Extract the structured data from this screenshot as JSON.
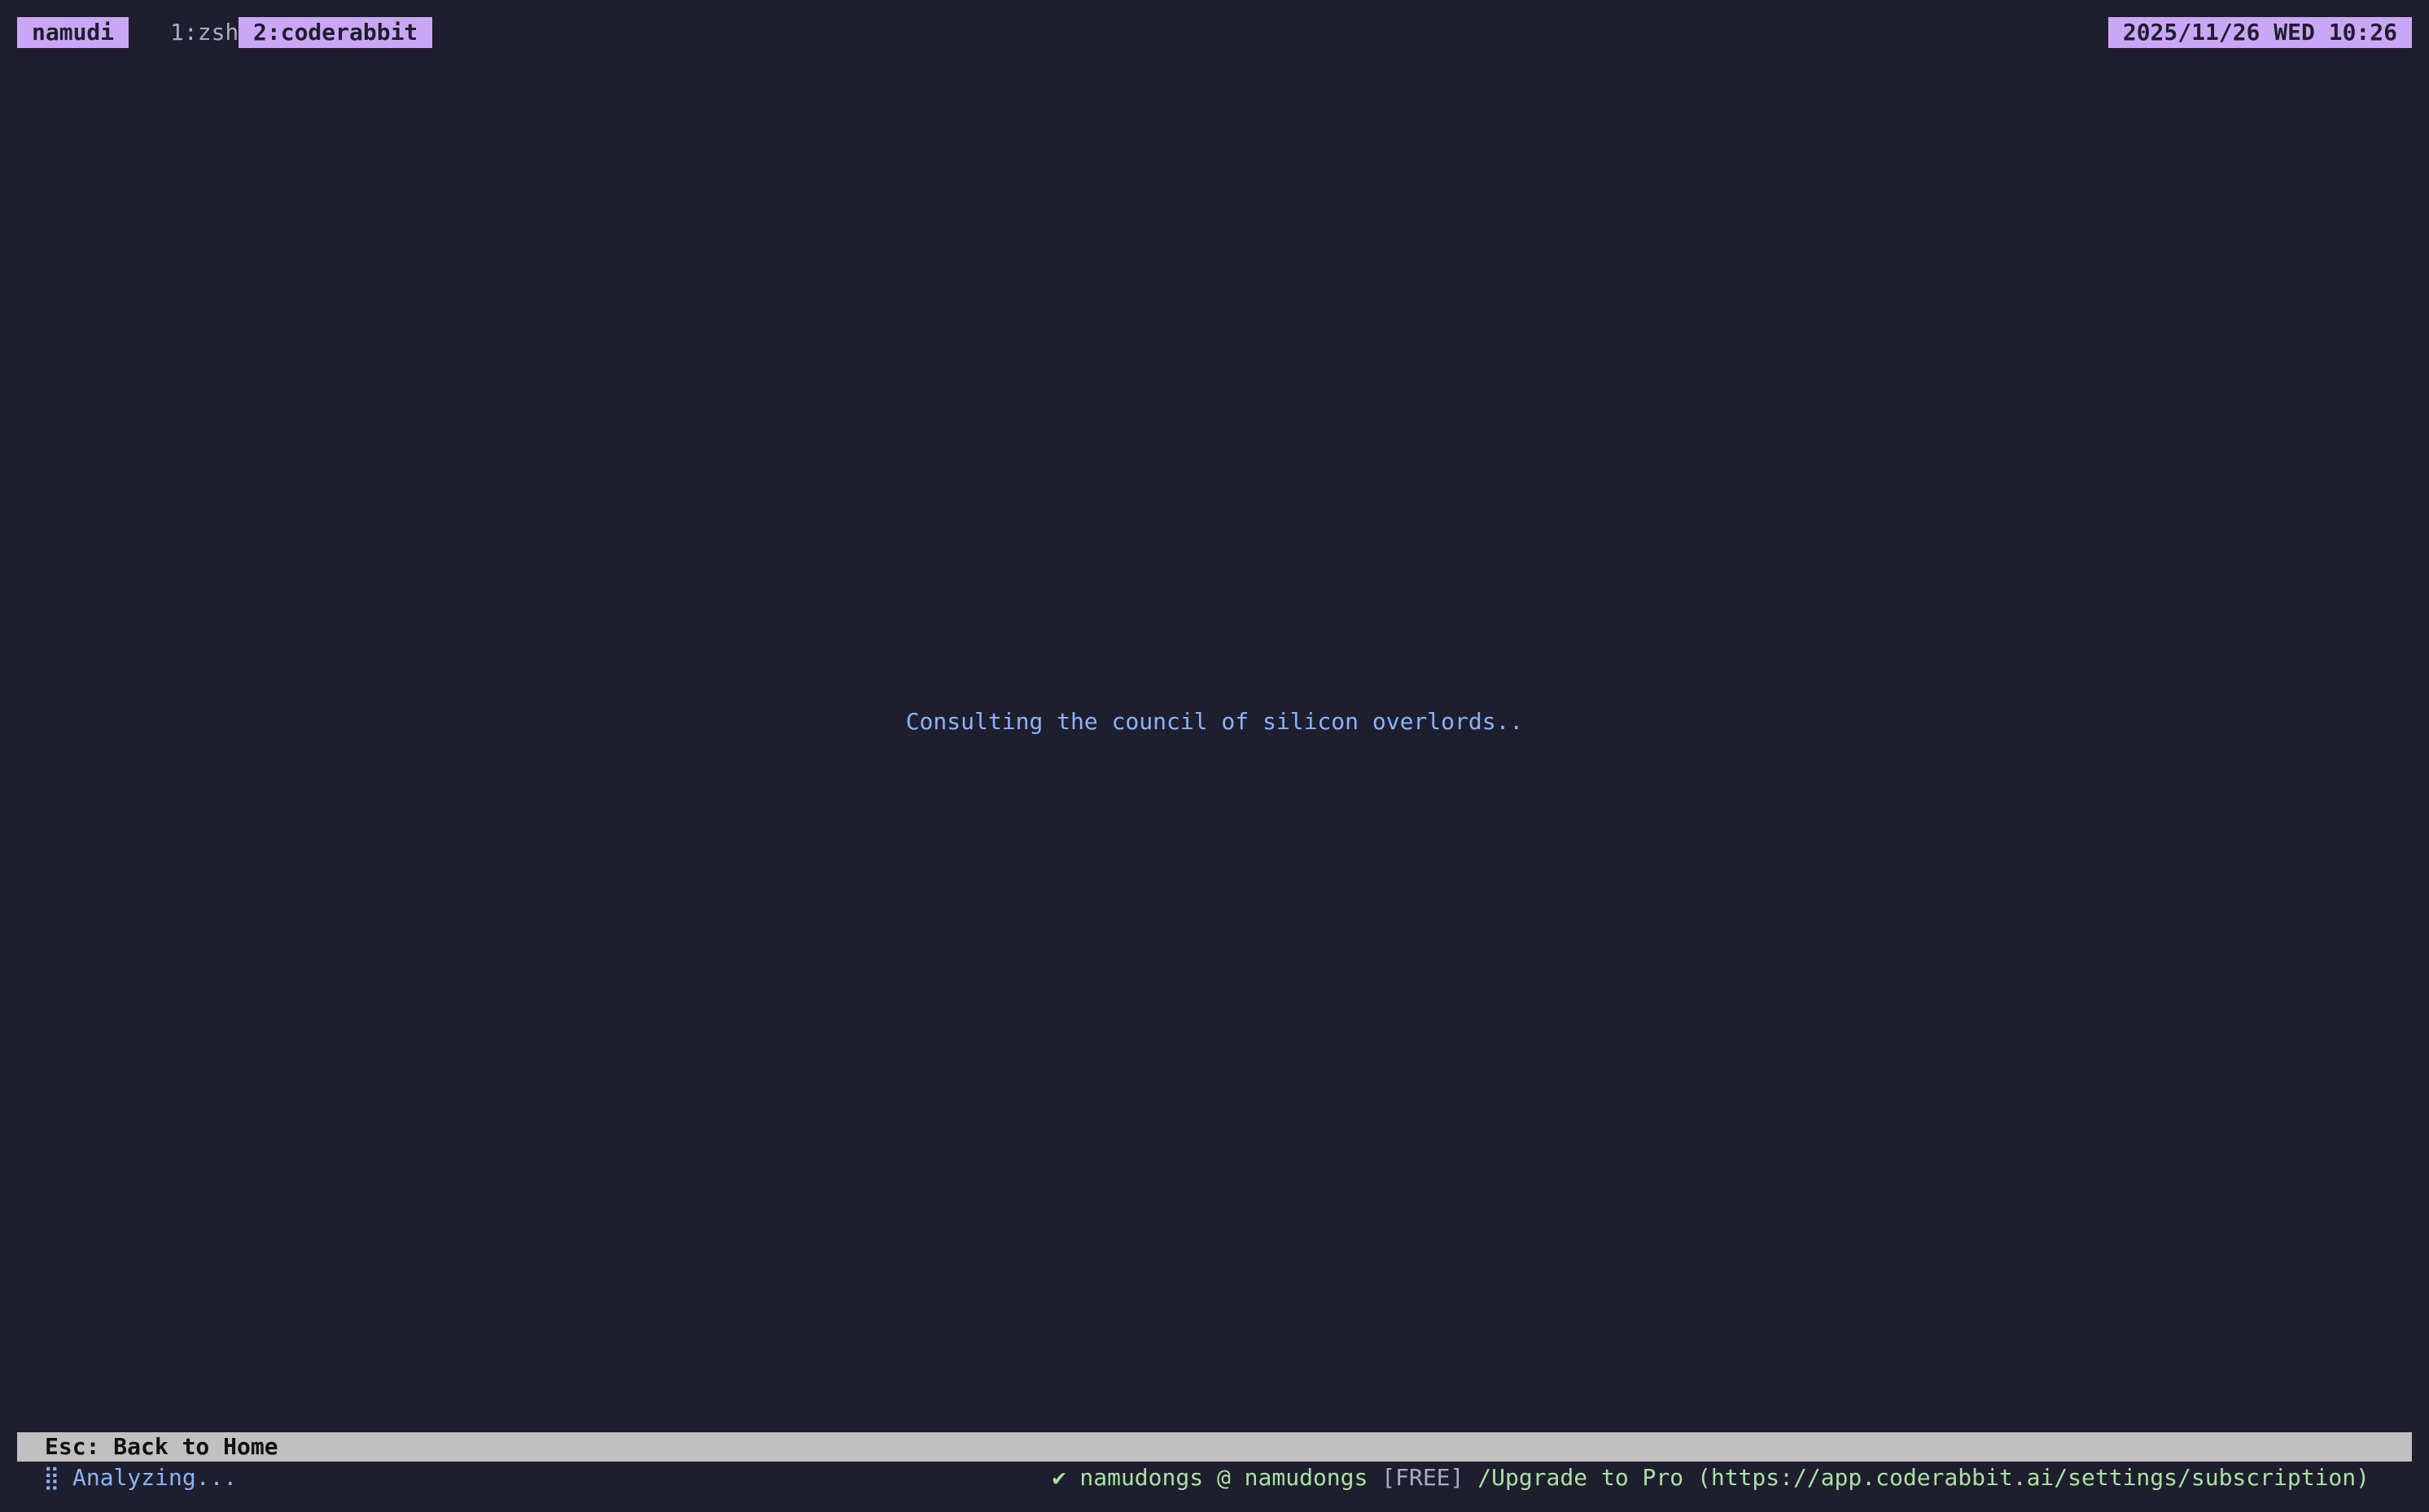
{
  "tmux": {
    "session": "namudi",
    "windows": [
      {
        "label": "1:zsh",
        "active": false
      },
      {
        "label": "2:coderabbit",
        "active": true
      }
    ],
    "clock": "2025/11/26 WED 10:26"
  },
  "main": {
    "message": "Consulting the council of silicon overlords.."
  },
  "footer": {
    "hint": "Esc: Back to Home",
    "spinner_glyph": "⣿",
    "status": "Analyzing...",
    "account": {
      "check": "✔",
      "user": "namudongs @ namudongs",
      "plan": "[FREE]",
      "upgrade": "/Upgrade to Pro (https://app.coderabbit.ai/settings/subscription)"
    }
  },
  "colors": {
    "background": "#1f1e2e",
    "accent": "#cba6f7",
    "message": "#89b4fa",
    "success": "#a6e3a1",
    "hint_bar": "#c0c0c0"
  },
  "icons": {
    "spinner": "braille-spinner-icon",
    "check": "check-icon"
  }
}
